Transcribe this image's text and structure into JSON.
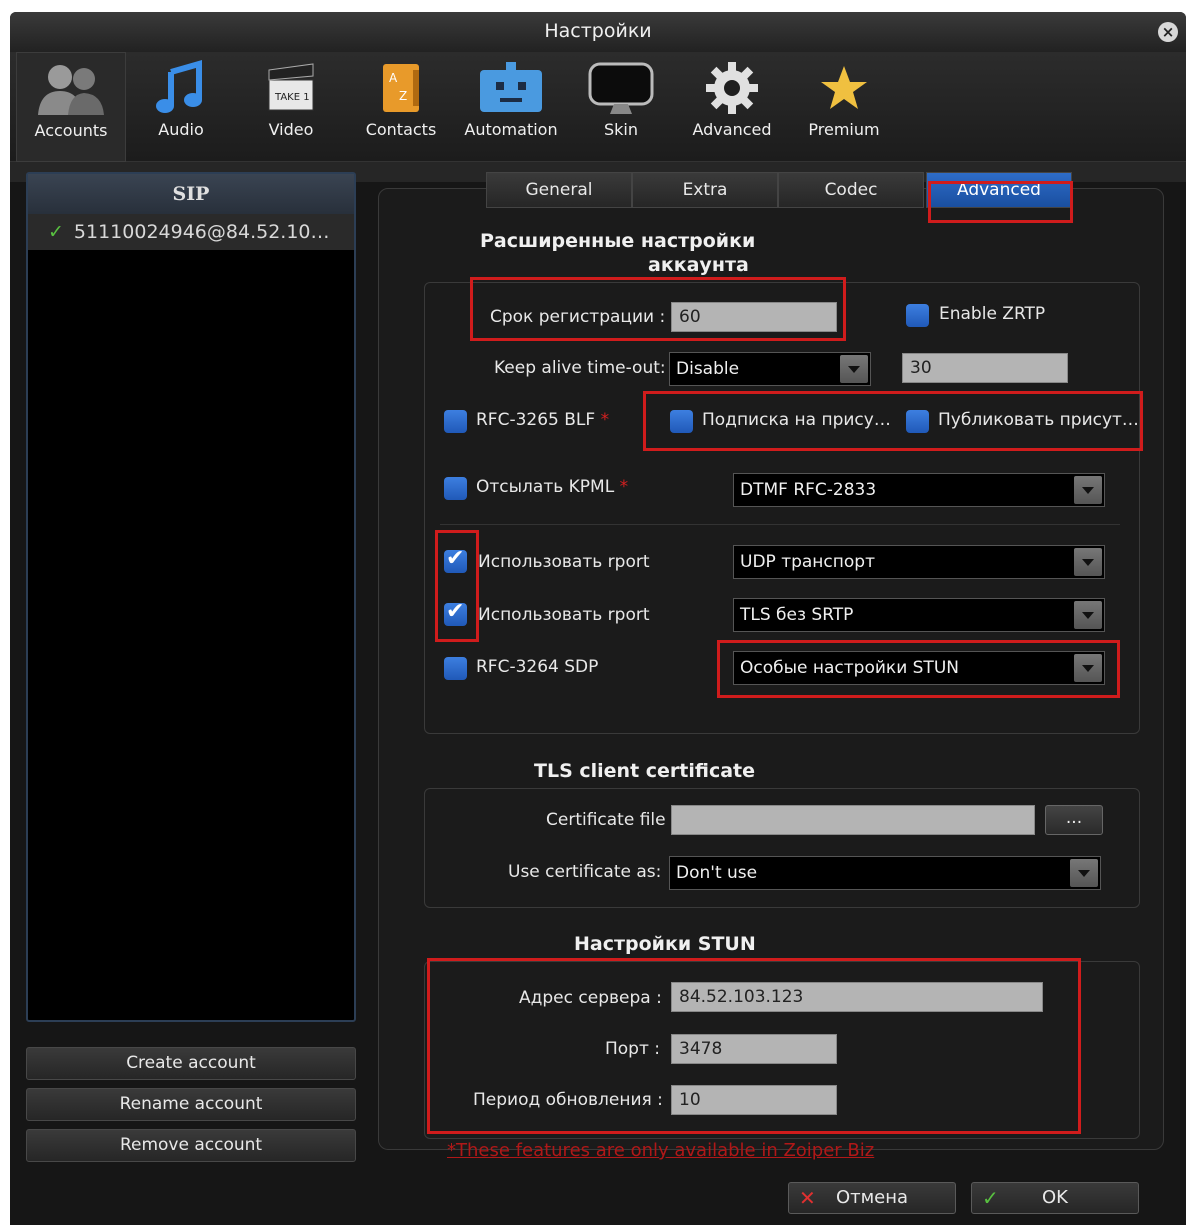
{
  "window": {
    "title": "Настройки"
  },
  "toolbar": {
    "items": [
      {
        "label": "Accounts",
        "icon": "users-icon"
      },
      {
        "label": "Audio",
        "icon": "music-note-icon"
      },
      {
        "label": "Video",
        "icon": "clapperboard-icon"
      },
      {
        "label": "Contacts",
        "icon": "address-book-icon"
      },
      {
        "label": "Automation",
        "icon": "robot-icon"
      },
      {
        "label": "Skin",
        "icon": "monitor-icon"
      },
      {
        "label": "Advanced",
        "icon": "gear-icon"
      },
      {
        "label": "Premium",
        "icon": "star-icon"
      }
    ]
  },
  "sidebar": {
    "header": "SIP",
    "accounts": [
      {
        "name": "51110024946@84.52.10…",
        "status_icon": "check-icon"
      }
    ],
    "buttons": {
      "create": "Create account",
      "rename": "Rename account",
      "remove": "Remove account"
    }
  },
  "tabs": [
    "General",
    "Extra",
    "Codec",
    "Advanced"
  ],
  "advanced": {
    "title_line1": "Расширенные настройки",
    "title_line2": "аккаунта",
    "reg_label": "Срок регистрации :",
    "reg_value": "60",
    "zrtp_label": "Enable ZRTP",
    "keepalive_label": "Keep alive time-out:",
    "keepalive_value": "Disable",
    "keepalive_seconds": "30",
    "blf_label": "RFC-3265 BLF",
    "asterisk": "*",
    "presence_subscribe_label": "Подписка на прису…",
    "presence_publish_label": "Публиковать присут…",
    "kpml_label": "Отсылать KPML",
    "dtmf_value": "DTMF RFC-2833",
    "rport1_label": "Использовать rport",
    "rport1_value": "UDP транспорт",
    "rport2_label": "Использовать rport",
    "rport2_value": "TLS без SRTP",
    "sdp_label": "RFC-3264 SDP",
    "stun_mode_value": "Особые настройки STUN"
  },
  "tls": {
    "title": "TLS client certificate",
    "cert_file_label": "Certificate file",
    "cert_file_value": "",
    "browse_label": "...",
    "use_as_label": "Use certificate as:",
    "use_as_value": "Don't use"
  },
  "stun": {
    "title": "Настройки STUN",
    "server_label": "Адрес сервера :",
    "server_value": "84.52.103.123",
    "port_label": "Порт :",
    "port_value": "3478",
    "refresh_label": "Период обновления :",
    "refresh_value": "10"
  },
  "footnote": "*These features are only available in Zoiper Biz",
  "footer": {
    "cancel": "Отмена",
    "ok": "OK"
  },
  "colors": {
    "accent": "#2e6cc8",
    "highlight": "#d01c1c",
    "checkbox": "#3d7fe0"
  }
}
